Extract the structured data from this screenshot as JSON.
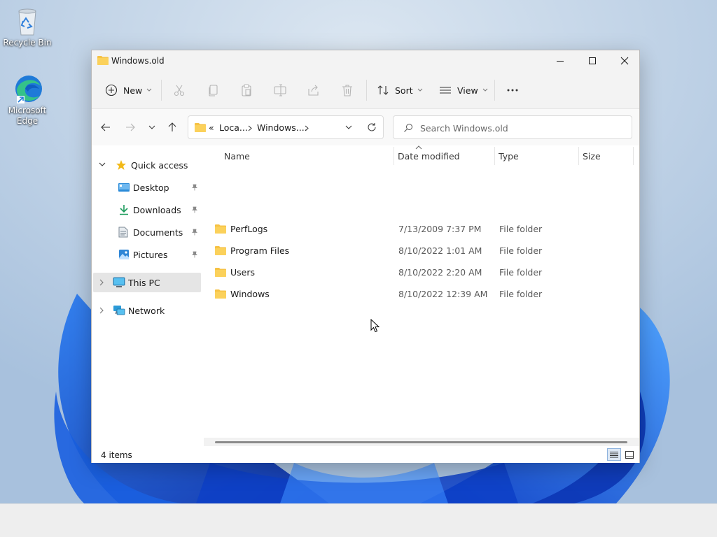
{
  "desktop": {
    "icons": [
      {
        "label": "Recycle Bin"
      },
      {
        "label": "Microsoft Edge"
      }
    ]
  },
  "window": {
    "title": "Windows.old",
    "controls": {
      "minimize": "minimize",
      "maximize": "maximize",
      "close": "close"
    }
  },
  "commandbar": {
    "new_label": "New",
    "sort_label": "Sort",
    "view_label": "View",
    "more_label": "···"
  },
  "navbar": {
    "breadcrumb": {
      "prefix": "«",
      "items": [
        "Loca...",
        "Windows...."
      ]
    },
    "search_placeholder": "Search Windows.old"
  },
  "sidebar": {
    "quick_access": "Quick access",
    "items": [
      {
        "label": "Desktop",
        "pinned": true
      },
      {
        "label": "Downloads",
        "pinned": true
      },
      {
        "label": "Documents",
        "pinned": true
      },
      {
        "label": "Pictures",
        "pinned": true
      }
    ],
    "this_pc": "This PC",
    "network": "Network"
  },
  "columns": {
    "name": "Name",
    "date": "Date modified",
    "type": "Type",
    "size": "Size"
  },
  "files": [
    {
      "name": "PerfLogs",
      "date": "7/13/2009 7:37 PM",
      "type": "File folder",
      "size": ""
    },
    {
      "name": "Program Files",
      "date": "8/10/2022 1:01 AM",
      "type": "File folder",
      "size": ""
    },
    {
      "name": "Users",
      "date": "8/10/2022 2:20 AM",
      "type": "File folder",
      "size": ""
    },
    {
      "name": "Windows",
      "date": "8/10/2022 12:39 AM",
      "type": "File folder",
      "size": ""
    }
  ],
  "status": {
    "count": "4 items"
  },
  "colors": {
    "folder": "#f6c244",
    "accent": "#0067c0",
    "selected": "#e5e5e5"
  }
}
